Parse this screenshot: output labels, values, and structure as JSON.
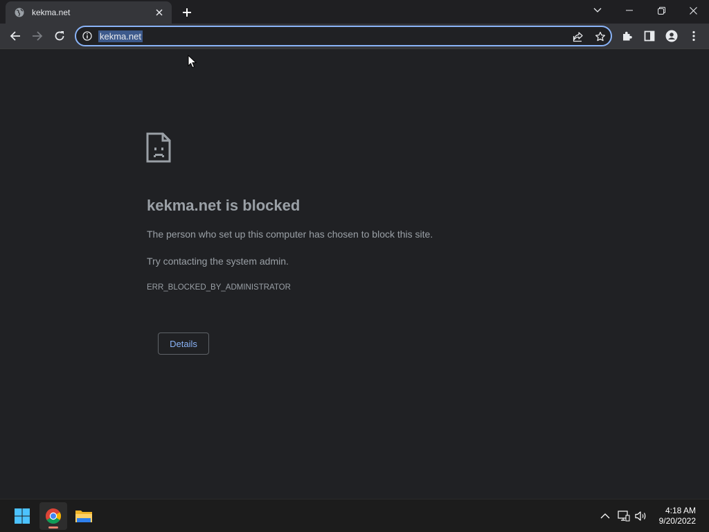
{
  "browser": {
    "tab": {
      "title": "kekma.net"
    },
    "address_bar": {
      "url": "kekma.net"
    }
  },
  "page": {
    "heading": "kekma.net is blocked",
    "description": "The person who set up this computer has chosen to block this site.",
    "hint": "Try contacting the system admin.",
    "error_code": "ERR_BLOCKED_BY_ADMINISTRATOR",
    "details_button": "Details"
  },
  "taskbar": {
    "apps": [
      "windows-start",
      "chrome",
      "file-explorer"
    ],
    "clock": {
      "time": "4:18 AM",
      "date": "9/20/2022"
    }
  },
  "colors": {
    "background": "#202124",
    "toolbar": "#35363a",
    "accent": "#8ab4f8",
    "muted_text": "#9aa0a6"
  }
}
